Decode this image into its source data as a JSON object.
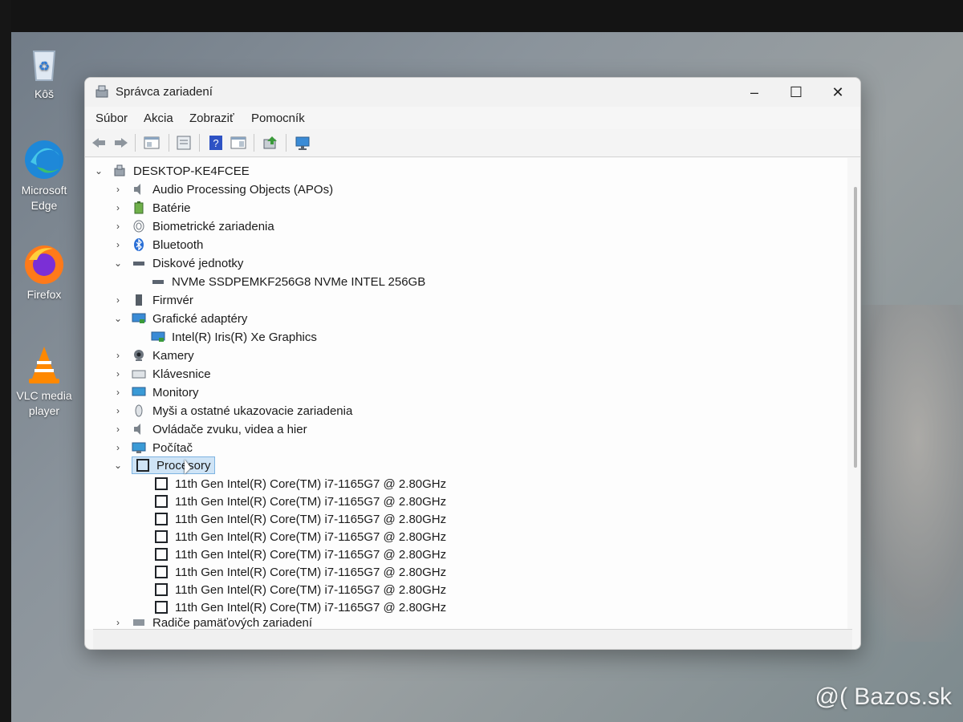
{
  "desktop": {
    "icons": [
      {
        "label_line1": "Kôš",
        "label_line2": "",
        "icon": "recycle-bin-icon"
      },
      {
        "label_line1": "Microsoft",
        "label_line2": "Edge",
        "icon": "edge-icon"
      },
      {
        "label_line1": "Firefox",
        "label_line2": "",
        "icon": "firefox-icon"
      },
      {
        "label_line1": "VLC media",
        "label_line2": "player",
        "icon": "vlc-icon"
      }
    ],
    "watermark": "@( Bazos.sk"
  },
  "window": {
    "title": "Správca zariadení",
    "controls": {
      "minimize": "–",
      "maximize": "☐",
      "close": "✕"
    }
  },
  "menubar": [
    "Súbor",
    "Akcia",
    "Zobraziť",
    "Pomocník"
  ],
  "tree": {
    "root": "DESKTOP-KE4FCEE",
    "categories": [
      {
        "label": "Audio Processing Objects (APOs)",
        "expanded": false
      },
      {
        "label": "Batérie",
        "expanded": false
      },
      {
        "label": "Biometrické zariadenia",
        "expanded": false
      },
      {
        "label": "Bluetooth",
        "expanded": false
      },
      {
        "label": "Diskové jednotky",
        "expanded": true
      },
      {
        "label": "NVMe SSDPEMKF256G8 NVMe INTEL 256GB",
        "child": true
      },
      {
        "label": "Firmvér",
        "expanded": false
      },
      {
        "label": "Grafické adaptéry",
        "expanded": true
      },
      {
        "label": "Intel(R) Iris(R) Xe Graphics",
        "child": true
      },
      {
        "label": "Kamery",
        "expanded": false
      },
      {
        "label": "Klávesnice",
        "expanded": false
      },
      {
        "label": "Monitory",
        "expanded": false
      },
      {
        "label": "Myši a ostatné ukazovacie zariadenia",
        "expanded": false
      },
      {
        "label": "Ovládače zvuku, videa a hier",
        "expanded": false
      },
      {
        "label": "Počítač",
        "expanded": false
      },
      {
        "label": "Procesory",
        "expanded": true,
        "selected": true
      }
    ],
    "processors": [
      "11th Gen Intel(R) Core(TM) i7-1165G7 @ 2.80GHz",
      "11th Gen Intel(R) Core(TM) i7-1165G7 @ 2.80GHz",
      "11th Gen Intel(R) Core(TM) i7-1165G7 @ 2.80GHz",
      "11th Gen Intel(R) Core(TM) i7-1165G7 @ 2.80GHz",
      "11th Gen Intel(R) Core(TM) i7-1165G7 @ 2.80GHz",
      "11th Gen Intel(R) Core(TM) i7-1165G7 @ 2.80GHz",
      "11th Gen Intel(R) Core(TM) i7-1165G7 @ 2.80GHz",
      "11th Gen Intel(R) Core(TM) i7-1165G7 @ 2.80GHz"
    ],
    "partial_last": "Radiče pamäťových zariadení"
  }
}
